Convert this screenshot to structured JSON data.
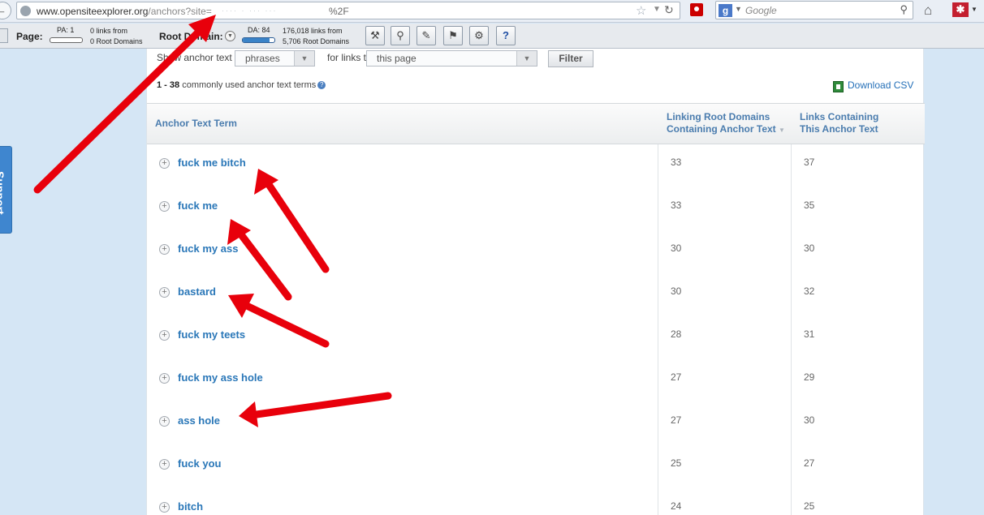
{
  "browser": {
    "url_host": "www.opensiteexplorer.org",
    "url_path": "/anchors?site=",
    "url_tail": "%2F",
    "search_placeholder": "Google"
  },
  "mozbar": {
    "page_label": "Page:",
    "pa": "PA: 1",
    "page_links": "0 links from",
    "page_root": "0 Root Domains",
    "root_label": "Root Domain:",
    "da": "DA: 84",
    "da_fill": 0.84,
    "root_links": "176,018 links from",
    "root_domains": "5,706 Root Domains",
    "tools": [
      "tools-icon",
      "search-icon",
      "highlight-icon",
      "flag-icon",
      "settings-icon",
      "help-icon"
    ]
  },
  "support_label": "Support",
  "filter": {
    "show_label": "Show anchor text",
    "type_value": "phrases",
    "for_links_label": "for links to",
    "scope_value": "this page",
    "button": "Filter"
  },
  "summary": {
    "range": "1 - 38",
    "text": " commonly used anchor text terms",
    "download": "Download CSV"
  },
  "table": {
    "headers": {
      "term": "Anchor Text Term",
      "root_1": "Linking Root Domains",
      "root_2": "Containing Anchor Text",
      "links_1": "Links Containing",
      "links_2": "This Anchor Text"
    },
    "rows": [
      {
        "term": "fuck me bitch",
        "root_domains": "33",
        "links": "37"
      },
      {
        "term": "fuck me",
        "root_domains": "33",
        "links": "35"
      },
      {
        "term": "fuck my ass",
        "root_domains": "30",
        "links": "30"
      },
      {
        "term": "bastard",
        "root_domains": "30",
        "links": "32"
      },
      {
        "term": "fuck my teets",
        "root_domains": "28",
        "links": "31"
      },
      {
        "term": "fuck my ass hole",
        "root_domains": "27",
        "links": "29"
      },
      {
        "term": "ass hole",
        "root_domains": "27",
        "links": "30"
      },
      {
        "term": "fuck you",
        "root_domains": "25",
        "links": "27"
      },
      {
        "term": "bitch",
        "root_domains": "24",
        "links": "25"
      }
    ]
  },
  "annotation_color": "#e8000b"
}
